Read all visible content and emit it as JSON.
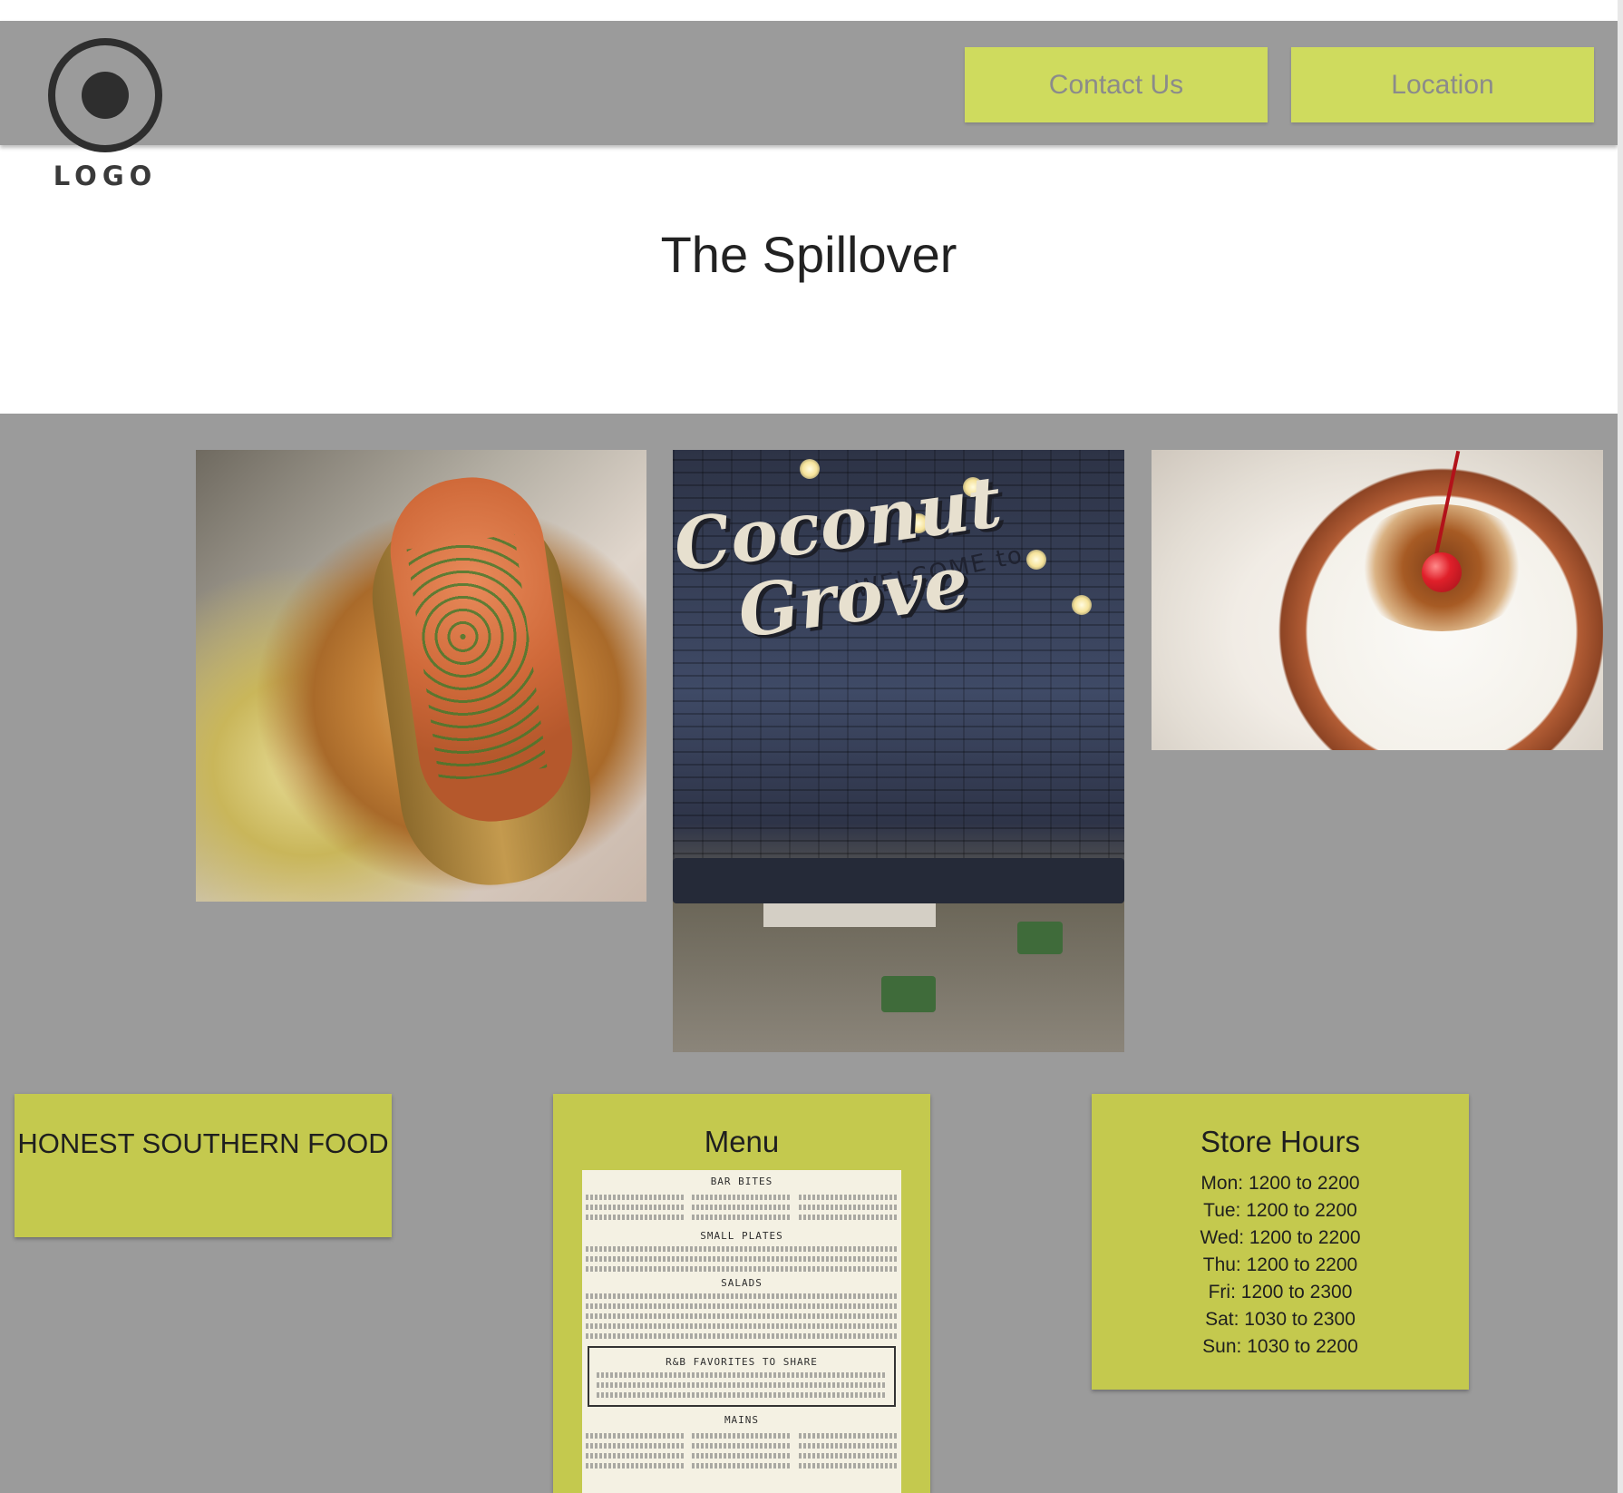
{
  "header": {
    "logo_text": "LOGO",
    "buttons": {
      "contact": "Contact Us",
      "location": "Location"
    }
  },
  "hero": {
    "title": "The Spillover"
  },
  "gallery": {
    "interior_sign_small": "WELCOME to",
    "interior_sign_line1": "Coconut",
    "interior_sign_line2": "Grove"
  },
  "cards": {
    "tagline": "HONEST SOUTHERN FOOD",
    "menu": {
      "title": "Menu",
      "sections": [
        "BAR BITES",
        "SMALL PLATES",
        "SALADS",
        "R&B FAVORITES TO SHARE",
        "MAINS"
      ]
    },
    "hours": {
      "title": "Store Hours",
      "rows": [
        "Mon: 1200 to 2200",
        "Tue: 1200 to 2200",
        "Wed: 1200 to 2200",
        "Thu: 1200 to 2200",
        "Fri: 1200 to 2300",
        "Sat: 1030 to 2300",
        "Sun: 1030 to 2200"
      ]
    }
  },
  "colors": {
    "header_bg": "#9b9b9b",
    "button_bg": "#cfdb5e",
    "card_bg": "#c4c94e"
  }
}
